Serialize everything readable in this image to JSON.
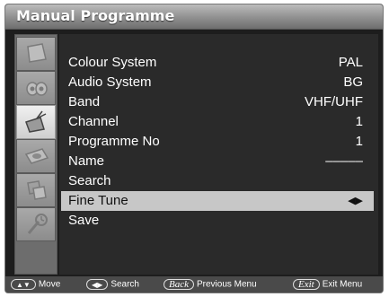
{
  "window": {
    "title": "Manual Programme"
  },
  "menu": {
    "rows": [
      {
        "label": "Colour System",
        "value": "PAL"
      },
      {
        "label": "Audio System",
        "value": "BG"
      },
      {
        "label": "Band",
        "value": "VHF/UHF"
      },
      {
        "label": "Channel",
        "value": "1"
      },
      {
        "label": "Programme No",
        "value": "1"
      },
      {
        "label": "Name",
        "value": "–––––"
      },
      {
        "label": "Search",
        "value": ""
      },
      {
        "label": "Fine Tune",
        "value": "◀▶"
      },
      {
        "label": "Save",
        "value": ""
      }
    ],
    "selected_index": 7
  },
  "sidebar": {
    "icons": [
      "picture-icon",
      "sound-icon",
      "channel-icon",
      "feature-icon",
      "source-icon",
      "setup-icon",
      "timer-icon"
    ],
    "active_index": 2
  },
  "footer": {
    "move_key": "▲▼",
    "move_label": "Move",
    "search_key": "◀▶",
    "search_label": "Search",
    "back_key": "Back",
    "back_label": "Previous Menu",
    "exit_key": "Exit",
    "exit_label": "Exit Menu"
  }
}
